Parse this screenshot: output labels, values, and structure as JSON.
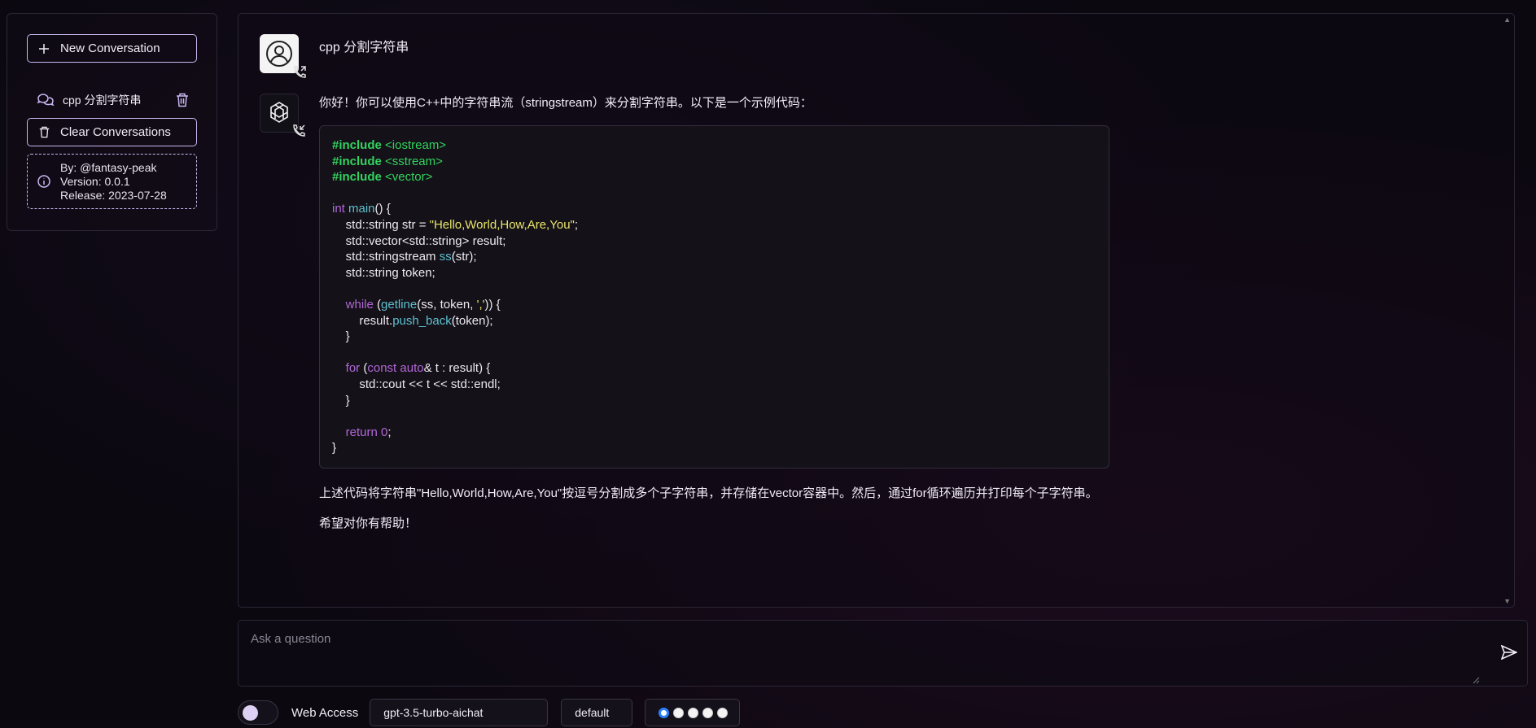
{
  "sidebar": {
    "new_conversation": "New Conversation",
    "conversation_title": "cpp 分割字符串",
    "clear_conversations": "Clear Conversations",
    "info": {
      "by": "By: @fantasy-peak",
      "version": "Version: 0.0.1",
      "release": "Release: 2023-07-28"
    }
  },
  "chat": {
    "user_message": "cpp 分割字符串",
    "bot_intro": "你好！你可以使用C++中的字符串流（stringstream）来分割字符串。以下是一个示例代码：",
    "code": {
      "inc1": "#include",
      "hdr1": "<iostream>",
      "inc2": "#include",
      "hdr2": "<sstream>",
      "inc3": "#include",
      "hdr3": "<vector>",
      "int_kw": "int",
      "main_fn": "main",
      "main_rest": "() {",
      "l1a": "    std::string str = ",
      "l1str": "\"Hello,World,How,Are,You\"",
      "l1b": ";",
      "l2": "    std::vector<std::string> result;",
      "l3a": "    std::stringstream ",
      "l3fn": "ss",
      "l3b": "(str);",
      "l4": "    std::string token;",
      "while_kw": "while",
      "while_a": " (",
      "getline_fn": "getline",
      "while_b": "(ss, token, ",
      "while_str": "','",
      "while_c": ")) {",
      "push_a": "        result.",
      "push_fn": "push_back",
      "push_b": "(token);",
      "close1": "    }",
      "for_kw": "for",
      "for_a": " (",
      "const_kw": "const auto",
      "for_b": "& t : result) {",
      "cout": "        std::cout << t << std::endl;",
      "close2": "    }",
      "return_kw": "return",
      "return_num": "0",
      "return_b": ";",
      "close3": "}"
    },
    "bot_outro": "上述代码将字符串\"Hello,World,How,Are,You\"按逗号分割成多个子字符串，并存储在vector容器中。然后，通过for循环遍历并打印每个子字符串。",
    "bot_thanks": "希望对你有帮助！"
  },
  "input": {
    "placeholder": "Ask a question",
    "value": ""
  },
  "bottom": {
    "web_access_label": "Web Access",
    "web_access_on": false,
    "model": "gpt-3.5-turbo-aichat",
    "preset": "default",
    "radio_selected_index": 0,
    "radio_count": 5
  },
  "colors": {
    "accent_border": "#c9b8f0",
    "code_include": "#33d35f",
    "code_keyword": "#b268d9",
    "code_function": "#5ec0d0",
    "code_string": "#e8e46a"
  }
}
